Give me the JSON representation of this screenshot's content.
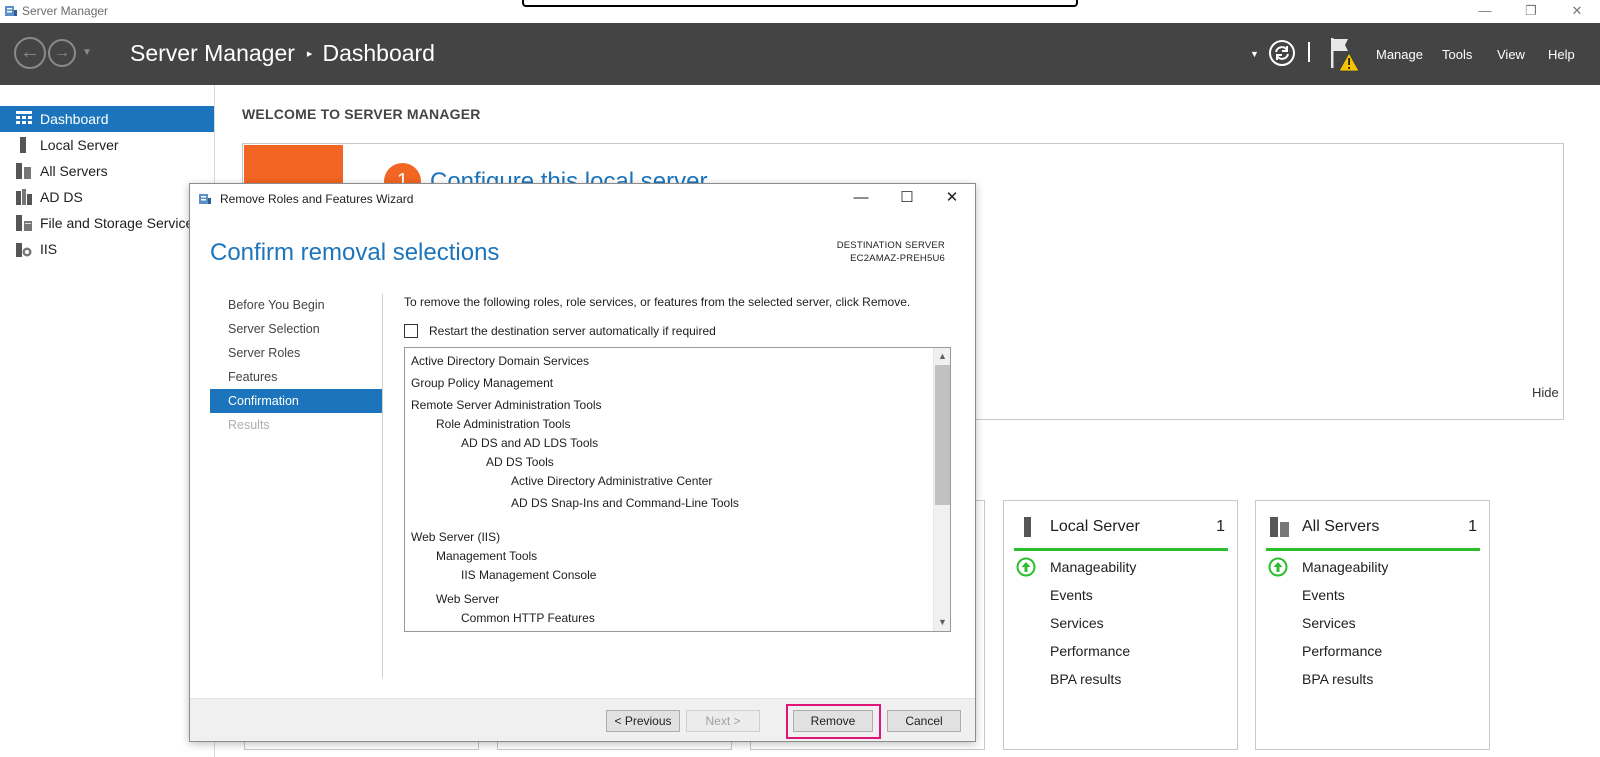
{
  "os_window": {
    "title": "Server Manager",
    "controls": {
      "minimize": "—",
      "restore": "❐",
      "close": "✕"
    }
  },
  "header": {
    "breadcrumb_app": "Server Manager",
    "breadcrumb_separator": "▸",
    "breadcrumb_page": "Dashboard",
    "menus": [
      "Manage",
      "Tools",
      "View",
      "Help"
    ]
  },
  "sidebar": {
    "items": [
      {
        "label": "Dashboard",
        "icon": "dashboard-grid-icon",
        "active": true
      },
      {
        "label": "Local Server",
        "icon": "server-icon"
      },
      {
        "label": "All Servers",
        "icon": "servers-icon"
      },
      {
        "label": "AD DS",
        "icon": "ad-ds-icon"
      },
      {
        "label": "File and Storage Services",
        "icon": "storage-icon"
      },
      {
        "label": "IIS",
        "icon": "iis-icon"
      }
    ]
  },
  "dashboard": {
    "welcome": "WELCOME TO SERVER MANAGER",
    "quickstart_step": "1",
    "quickstart_title": "Configure this local server",
    "hide": "Hide",
    "tiles": [
      {
        "title": "Local Server",
        "count": "1",
        "rows": [
          "Manageability",
          "Events",
          "Services",
          "Performance",
          "BPA results"
        ]
      },
      {
        "title": "All Servers",
        "count": "1",
        "rows": [
          "Manageability",
          "Events",
          "Services",
          "Performance",
          "BPA results"
        ]
      }
    ],
    "status_color": "#2dbe2d"
  },
  "dialog": {
    "title": "Remove Roles and Features Wizard",
    "heading": "Confirm removal selections",
    "destination_label": "DESTINATION SERVER",
    "destination_value": "EC2AMAZ-PREH5U6",
    "steps": [
      {
        "label": "Before You Begin",
        "state": "normal"
      },
      {
        "label": "Server Selection",
        "state": "normal"
      },
      {
        "label": "Server Roles",
        "state": "normal"
      },
      {
        "label": "Features",
        "state": "normal"
      },
      {
        "label": "Confirmation",
        "state": "active"
      },
      {
        "label": "Results",
        "state": "disabled"
      }
    ],
    "instruction": "To remove the following roles, role services, or features from the selected server, click Remove.",
    "restart_checkbox_label": "Restart the destination server automatically if required",
    "restart_checked": false,
    "removal_items": [
      {
        "text": "Active Directory Domain Services",
        "level": 0
      },
      {
        "text": "Group Policy Management",
        "level": 0
      },
      {
        "text": "Remote Server Administration Tools",
        "level": 0
      },
      {
        "text": "Role Administration Tools",
        "level": 1
      },
      {
        "text": "AD DS and AD LDS Tools",
        "level": 2
      },
      {
        "text": "AD DS Tools",
        "level": 3
      },
      {
        "text": "Active Directory Administrative Center",
        "level": 4
      },
      {
        "text": "AD DS Snap-Ins and Command-Line Tools",
        "level": 4
      },
      {
        "text": "Web Server (IIS)",
        "level": 0
      },
      {
        "text": "Management Tools",
        "level": 1
      },
      {
        "text": "IIS Management Console",
        "level": 2
      },
      {
        "text": "Web Server",
        "level": 1
      },
      {
        "text": "Common HTTP Features",
        "level": 2
      }
    ],
    "buttons": {
      "previous": "< Previous",
      "next": "Next >",
      "remove": "Remove",
      "cancel": "Cancel"
    },
    "accent_color": "#1c75bc",
    "highlight_color": "#e0157a"
  }
}
